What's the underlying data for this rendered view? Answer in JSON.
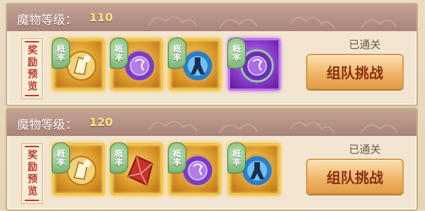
{
  "panels": [
    {
      "level_label": "魔物等级：",
      "level_value": "110",
      "reward_preview": "奖励预览",
      "status": "已通关",
      "team_button": "组队挑战",
      "items": [
        {
          "prob": "概率",
          "icon": "gold-orb-icon",
          "rarity": "gold"
        },
        {
          "prob": "概率",
          "icon": "purple-orb-icon",
          "rarity": "gold"
        },
        {
          "prob": "概率",
          "icon": "warrior-scroll-icon",
          "rarity": "gold"
        },
        {
          "prob": "概率",
          "icon": "purple-orb-icon",
          "rarity": "purple"
        }
      ]
    },
    {
      "level_label": "魔物等级：",
      "level_value": "120",
      "reward_preview": "奖励预览",
      "status": "已通关",
      "team_button": "组队挑战",
      "items": [
        {
          "prob": "概率",
          "icon": "gold-orb-icon",
          "rarity": "gold"
        },
        {
          "prob": "概率",
          "icon": "red-crystal-icon",
          "rarity": "gold"
        },
        {
          "prob": "概率",
          "icon": "purple-orb-icon",
          "rarity": "gold"
        },
        {
          "prob": "概率",
          "icon": "warrior-scroll-icon",
          "rarity": "gold"
        }
      ]
    }
  ],
  "colors": {
    "header": "#b08c80",
    "level_value": "#ffe680",
    "reward_tag_text": "#c0392b",
    "button_text": "#8a2f10"
  }
}
